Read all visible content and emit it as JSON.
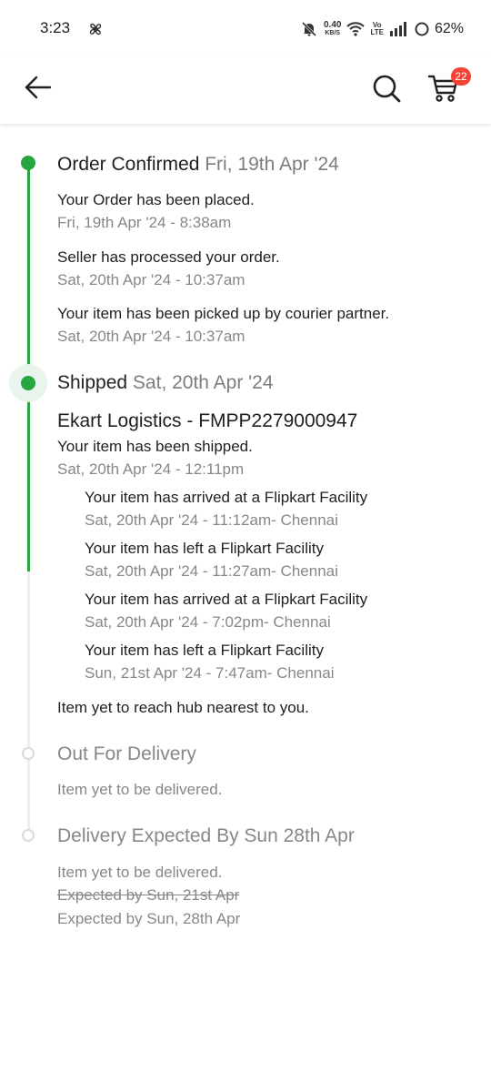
{
  "status_bar": {
    "time": "3:23",
    "speed_value": "0.40",
    "speed_unit": "KB/S",
    "volte_top": "Vo",
    "volte_bottom": "LTE",
    "battery": "62%"
  },
  "header": {
    "back_icon": "arrow-left-icon",
    "search_icon": "search-icon",
    "cart_icon": "cart-icon",
    "cart_count": "22"
  },
  "colors": {
    "accent_green": "#26a541",
    "badge_red": "#f44336",
    "muted_text": "#878787"
  },
  "timeline": {
    "order_confirmed": {
      "title": "Order Confirmed",
      "date": "Fri, 19th Apr '24",
      "events": [
        {
          "text": "Your Order has been placed.",
          "time": "Fri, 19th Apr '24 - 8:38am"
        },
        {
          "text": "Seller has processed your order.",
          "time": "Sat, 20th Apr '24 - 10:37am"
        },
        {
          "text": "Your item has been picked up by courier partner.",
          "time": "Sat, 20th Apr '24 - 10:37am"
        }
      ]
    },
    "shipped": {
      "title": "Shipped",
      "date": "Sat, 20th Apr '24",
      "courier": "Ekart Logistics - FMPP2279000947",
      "event_text": "Your item has been shipped.",
      "event_time": "Sat, 20th Apr '24 - 12:11pm",
      "facility_events": [
        {
          "text": "Your item has arrived at a Flipkart Facility",
          "time": "Sat, 20th Apr '24 - 11:12am- Chennai"
        },
        {
          "text": "Your item has left a Flipkart Facility",
          "time": "Sat, 20th Apr '24 - 11:27am- Chennai"
        },
        {
          "text": "Your item has arrived at a Flipkart Facility",
          "time": "Sat, 20th Apr '24 - 7:02pm- Chennai"
        },
        {
          "text": "Your item has left a Flipkart Facility",
          "time": "Sun, 21st Apr '24 - 7:47am- Chennai"
        }
      ],
      "hub_note": "Item yet to reach hub nearest to you."
    },
    "out_for_delivery": {
      "title": "Out For Delivery",
      "note": "Item yet to be delivered."
    },
    "delivery_expected": {
      "title": "Delivery Expected By Sun 28th Apr",
      "note": "Item yet to be delivered.",
      "old_expected": "Expected by Sun, 21st Apr",
      "new_expected": "Expected by Sun, 28th Apr"
    }
  }
}
